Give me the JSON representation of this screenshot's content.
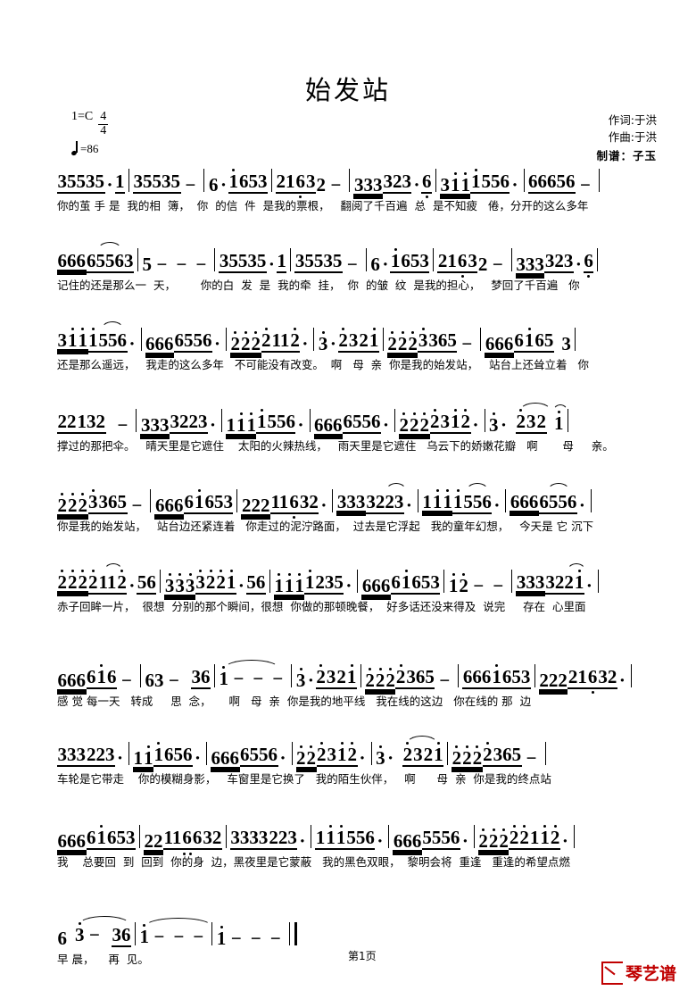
{
  "document": {
    "title": "始发站",
    "page_label": "第1页",
    "watermark": "琴艺谱",
    "brand_color": "#c00000"
  },
  "header": {
    "key_label": "1=C",
    "meter_numerator": "4",
    "meter_denominator": "4",
    "tempo_text": "=86",
    "lyricist": "作词:于洪",
    "composer": "作曲:于洪",
    "engraver": "制谱：子玉"
  },
  "systems": [
    {
      "index": 1,
      "measures": [
        "35535·1",
        "35535 −",
        "6·1̇653",
        "2163̣2 −",
        "333323·6̣",
        "31̇1̇1̇556·",
        "66656 −"
      ],
      "lyrics": "你的茧 手 是  我的相  簿，  你  的信  件  是我的票根，   翻阅了千百遍  总  是不知疲   倦，分开的这么多年"
    },
    {
      "index": 2,
      "measures": [
        "66665563",
        "5 − − −",
        "35535·1",
        "35535 −",
        "6·1̇653",
        "2163̣2 −",
        "333323·6̣"
      ],
      "lyrics": "记住的还是那么一  天，       你的白  发  是  我的牵  挂，  你  的皱  纹  是我的担心，   梦回了千百遍   你"
    },
    {
      "index": 3,
      "measures": [
        "31̇1̇1̇556·",
        "6666556·",
        "2̇2̇2̇2̇11̇2̇·",
        "3̇·2̇32̇1̇",
        "2̇2̇2̇3̇365 −",
        "66661̇65  3"
      ],
      "lyrics": "还是那么遥远，   我走的这么多年   不可能没有改变。  啊   母  亲  你是我的始发站，   站台上还耸立着   你"
    },
    {
      "index": 4,
      "measures": [
        "22132  −",
        "3333223·",
        "11̇1̇1̇556·",
        "6666556·",
        "2̇2̇2̇2̇31̇2̇·",
        "3̇·  2̇32̇  1̇"
      ],
      "lyrics": "撑过的那把伞。   晴天里是它遮住    太阳的火辣热线，   雨天里是它遮住   乌云下的娇嫩花瓣   啊       母     亲。"
    },
    {
      "index": 5,
      "measures": [
        "2̇2̇2̇3̇365 −",
        "66661̇653",
        "22116̣32·",
        "3333223·",
        "11̇1̇1̇556·",
        "6666556·"
      ],
      "lyrics": "你是我的始发站，   站台边还紧连着   你走过的泥泞路面，  过去是它浮起   我的童年幻想，   今天是 它 沉下"
    },
    {
      "index": 6,
      "measures": [
        "2̇2̇2̇2̇11̇2̇·56",
        "3̇3̇3̇3̇2̇2̇1̇·56",
        "1̇1̇1̇1̇235·",
        "66661̇653",
        "1̇2̇ − −",
        "3333221̇·"
      ],
      "lyrics": "赤子回眸一片，  很想  分别的那个瞬间，很想  你做的那顿晚餐，  好多话还没来得及  说完     存在  心里面"
    },
    {
      "index": 7,
      "measures": [
        "666616 −",
        "63 − 36",
        "1̇ − − −",
        "3̇·2̇32̇1̇",
        "2̇2̇2̇2̇365 −",
        "6661̇653",
        "22221̣632·"
      ],
      "lyrics": "感 觉 每一天   转成     思  念，     啊   母  亲  你是我的地平线   我在线的这边   你在线的 那  边"
    },
    {
      "index": 8,
      "measures": [
        "333223·",
        "11̇1̇656·",
        "6666556·",
        "2̇2̇2̇31̇2̇·",
        "3̇·  2̇32̇1̇",
        "2̇2̇2̇2̇365 −"
      ],
      "lyrics": "车轮是它带走    你的模糊身影，   车窗里是它换了   我的陌生伙伴，   啊      母  亲  你是我的终点站"
    },
    {
      "index": 9,
      "measures": [
        "66661̇653",
        "22116̣6̣32",
        "3333223·",
        "11̇1̇556·",
        "6665556·",
        "2̇2̇2̇2̇2̇11̇2̇·"
      ],
      "lyrics": "我    总要回  到  回到  你的身  边，黑夜里是它蒙蔽   我的黑色双眼，  黎明会将  重逢   重逢的希望点燃"
    },
    {
      "index": 10,
      "measures": [
        "6 3 − 36",
        "1̇ − − −",
        "1̇ − − −"
      ],
      "lyrics": "早 晨，    再  见。"
    }
  ]
}
